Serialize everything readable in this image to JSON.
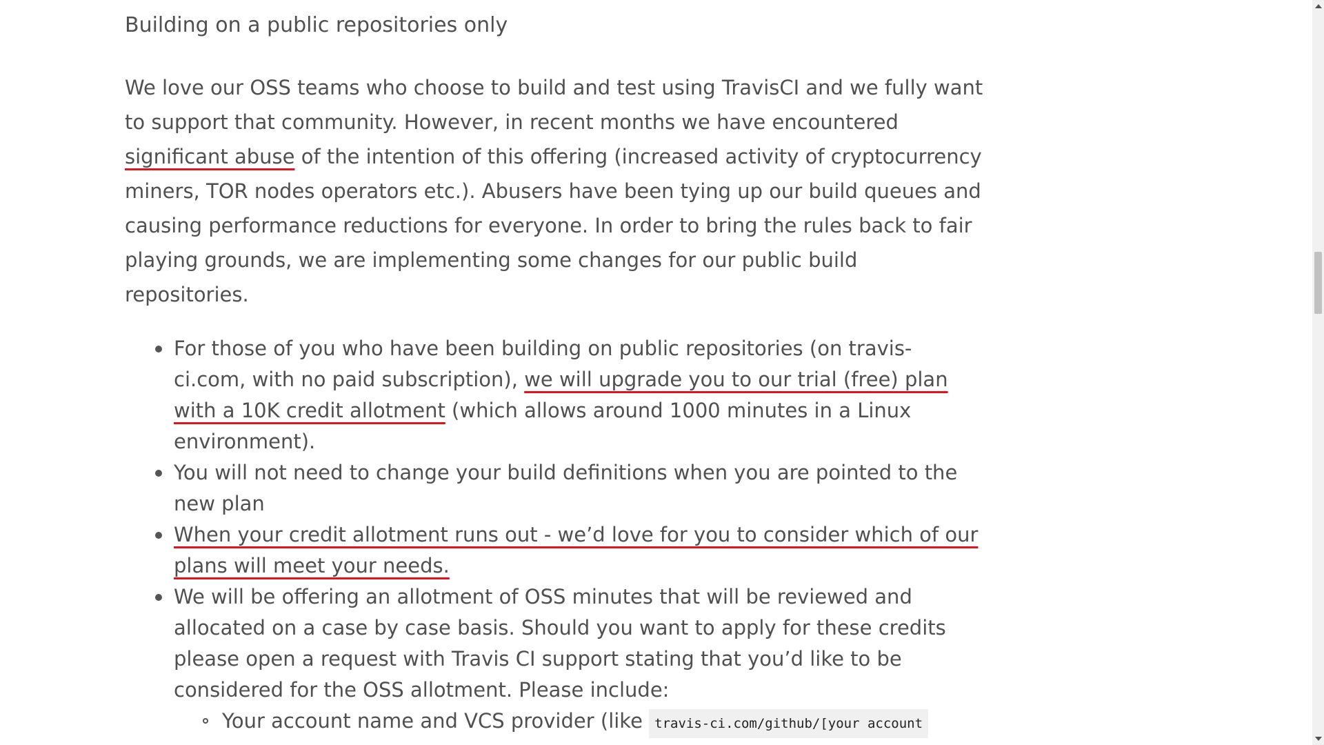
{
  "article": {
    "heading": "Building on a public repositories only",
    "paragraph": {
      "l1": "We love our OSS teams who choose to build and test using TravisCI and we fully want",
      "l2": "to support that community. However, in recent months we have encountered",
      "l3_mark": "significant abuse",
      "l3_rest": " of the intention of this offering (increased activity of cryptocurrency",
      "l4": "miners, TOR nodes operators etc.). Abusers have been tying up our build queues and",
      "l5": "causing performance reductions for everyone. In order to bring the rules back to fair",
      "l6": "playing grounds, we are implementing some changes for our public build",
      "l7": "repositories."
    },
    "bullet1": {
      "l1": "For those of you who have been building on public repositories (on travis-",
      "l2_pre": "ci.com, with no paid subscription), ",
      "l2_mark": "we will upgrade you to our trial (free) plan",
      "l3_mark": "with a 10K credit allotment",
      "l3_rest": " (which allows around 1000 minutes in a Linux",
      "l4": "environment)."
    },
    "bullet2": {
      "l1": "You will not need to change your build definitions when you are pointed to the",
      "l2": "new plan"
    },
    "bullet3": {
      "l1_mark": "When your credit allotment runs out - we’d love for you to consider which of our",
      "l2_mark": "plans will meet your needs."
    },
    "bullet4": {
      "l1": "We will be offering an allotment of OSS minutes that will be reviewed and",
      "l2": "allocated on a case by case basis. Should you want to apply for these credits",
      "l3": "please open a request with Travis CI support stating that you’d like to be",
      "l4": "considered for the OSS allotment. Please include:"
    },
    "subbullet1": {
      "text": "Your account name and VCS provider (like ",
      "code": "travis-ci.com/github/[your account"
    }
  },
  "colors": {
    "text": "#505050",
    "highlight_underline": "#e0141f",
    "code_background": "#f0f0f0"
  }
}
